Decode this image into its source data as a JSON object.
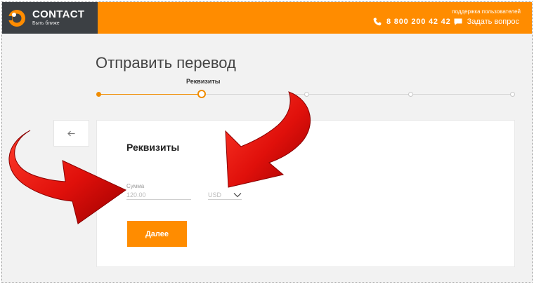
{
  "header": {
    "brand_name": "CONTACT",
    "brand_tagline": "Быть ближе",
    "support_label": "поддержка пользователей",
    "phone_number": "8 800 200 42 42",
    "ask_label": "Задать вопрос",
    "colors": {
      "accent": "#ff8c00",
      "logo_bg": "#3c4044"
    }
  },
  "page": {
    "title": "Отправить перевод",
    "current_step_label": "Реквизиты",
    "steps": {
      "total": 5,
      "current": 2
    }
  },
  "form": {
    "title": "Реквизиты",
    "amount_label": "Сумма",
    "amount_value": "120.00",
    "currency_value": "USD",
    "next_label": "Далее"
  },
  "overlay": {
    "arrow_color": "#e0100b"
  }
}
